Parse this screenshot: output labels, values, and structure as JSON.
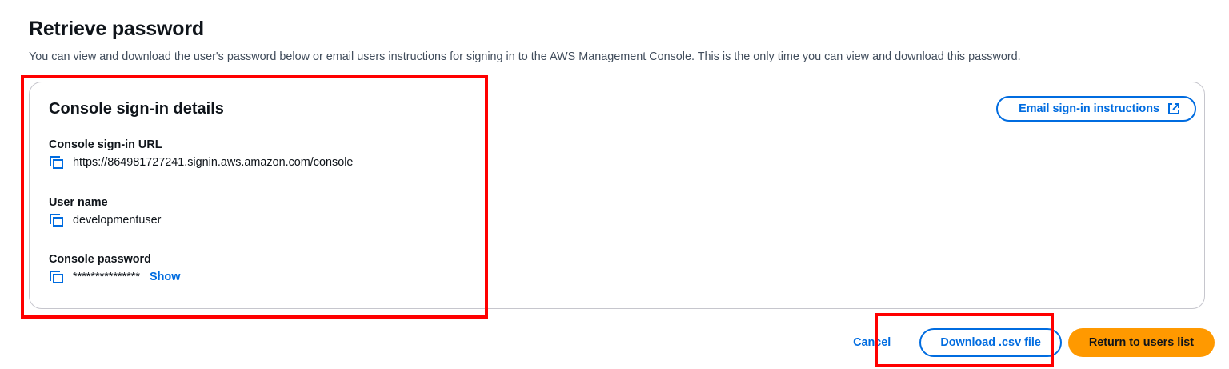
{
  "page": {
    "title": "Retrieve password",
    "description": "You can view and download the user's password below or email users instructions for signing in to the AWS Management Console. This is the only time you can view and download this password."
  },
  "panel": {
    "title": "Console sign-in details",
    "email_button_label": "Email sign-in instructions",
    "email_button_icon": "external-link-icon",
    "fields": {
      "signin_url": {
        "label": "Console sign-in URL",
        "value": "https://864981727241.signin.aws.amazon.com/console"
      },
      "user_name": {
        "label": "User name",
        "value": "developmentuser"
      },
      "password": {
        "label": "Console password",
        "value": "***************",
        "show_label": "Show"
      }
    }
  },
  "actions": {
    "cancel_label": "Cancel",
    "download_label": "Download .csv file",
    "return_label": "Return to users list"
  },
  "colors": {
    "link_blue": "#006ce0",
    "primary_orange": "#ff9900",
    "highlight_red": "#ff0000",
    "text_dark": "#0f141a",
    "text_muted": "#414d5c",
    "border_gray": "#c6c6cd"
  },
  "icons": {
    "copy": "copy-icon",
    "external": "external-link-icon"
  }
}
